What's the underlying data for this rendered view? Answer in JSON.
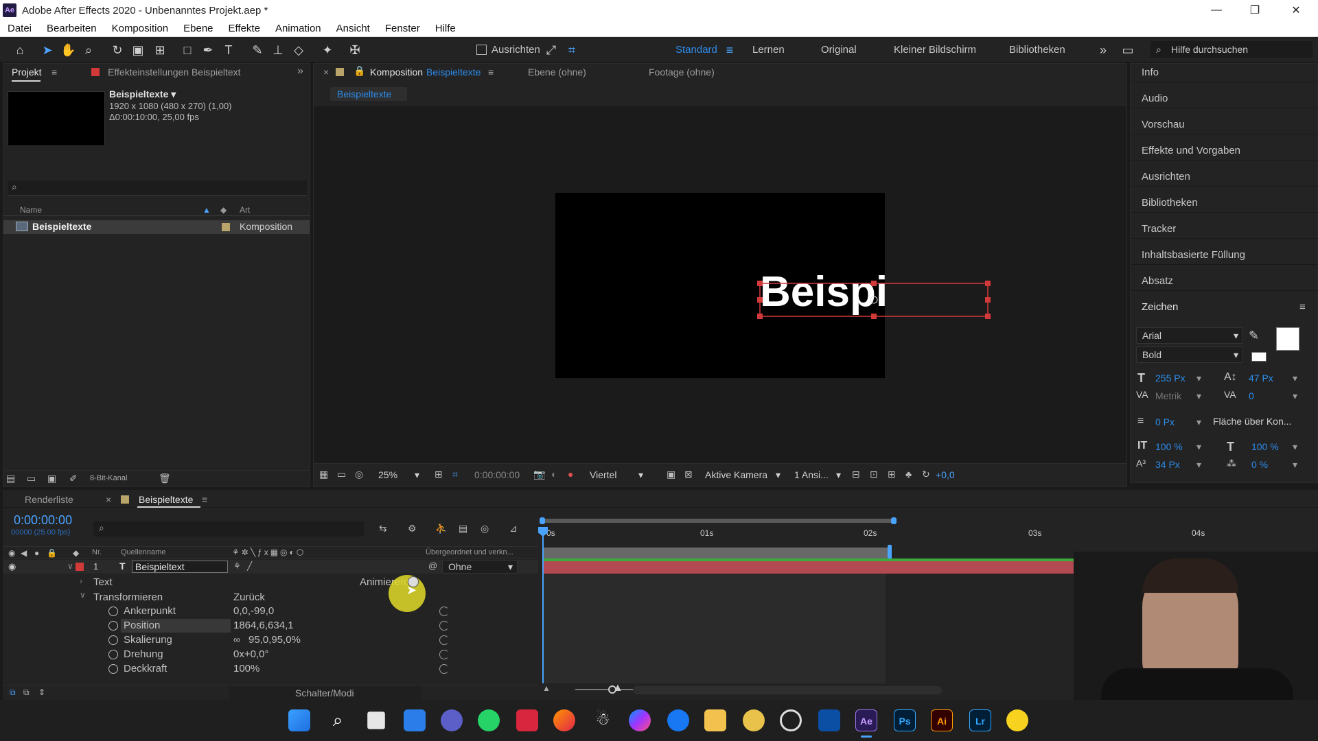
{
  "window": {
    "title": "Adobe After Effects 2020 - Unbenanntes Projekt.aep *",
    "logo": "Ae",
    "minimize": "—",
    "maximize": "❐",
    "close": "✕"
  },
  "menu": [
    "Datei",
    "Bearbeiten",
    "Komposition",
    "Ebene",
    "Effekte",
    "Animation",
    "Ansicht",
    "Fenster",
    "Hilfe"
  ],
  "toolbar": {
    "align_label": "Ausrichten",
    "workspaces": [
      "Standard",
      "Lernen",
      "Original",
      "Kleiner Bildschirm",
      "Bibliotheken"
    ],
    "help_placeholder": "Hilfe durchsuchen"
  },
  "project": {
    "tab_project": "Projekt",
    "tab_effects": "Effekteinstellungen Beispieltext",
    "comp_name": "Beispieltexte ▾",
    "comp_info1": "1920 x 1080 (480 x 270) (1,00)",
    "comp_info2": "Δ0:00:10:00, 25,00 fps",
    "col_name": "Name",
    "col_type": "Art",
    "item_name": "Beispieltexte",
    "item_type": "Komposition",
    "bitdepth": "8-Bit-Kanal"
  },
  "viewer": {
    "tab_comp_prefix": "Komposition",
    "tab_comp_name": "Beispieltexte",
    "tab_layer": "Ebene (ohne)",
    "tab_footage": "Footage (ohne)",
    "breadcrumb": "Beispieltexte",
    "canvas_text": "Beispi",
    "zoom": "25%",
    "time": "0:00:00:00",
    "resolution": "Viertel",
    "camera": "Aktive Kamera",
    "views": "1 Ansi...",
    "exposure": "+0,0"
  },
  "right_panel": {
    "items": [
      "Info",
      "Audio",
      "Vorschau",
      "Effekte und Vorgaben",
      "Ausrichten",
      "Bibliotheken",
      "Tracker",
      "Inhaltsbasierte Füllung",
      "Absatz"
    ],
    "zeichen": "Zeichen",
    "font": "Arial",
    "style": "Bold",
    "font_size": "255 Px",
    "leading": "47 Px",
    "kerning": "Metrik",
    "tracking": "0",
    "stroke_width": "0 Px",
    "stroke_type": "Fläche über Kon...",
    "vscale": "100 %",
    "hscale": "100 %",
    "baseline": "34 Px",
    "tsume": "0 %",
    "fill_color": "#ffffff",
    "stroke_color": "#000000"
  },
  "timeline": {
    "tab_render": "Renderliste",
    "tab_comp": "Beispieltexte",
    "timecode": "0:00:00:00",
    "frames": "00000 (25.00 fps)",
    "col_nr": "Nr.",
    "col_source": "Quellenname",
    "col_parent": "Übergeordnet und verkn...",
    "layer_nr": "1",
    "layer_type_icon": "T",
    "layer_name": "Beispieltext",
    "parent_value": "Ohne",
    "text_group": "Text",
    "animate": "Animieren:",
    "transform_group": "Transformieren",
    "reset": "Zurück",
    "properties": [
      {
        "name": "Ankerpunkt",
        "value": "0,0,-99,0"
      },
      {
        "name": "Position",
        "value": "1864,6,634,1"
      },
      {
        "name": "Skalierung",
        "value": "95,0,95,0%"
      },
      {
        "name": "Drehung",
        "value": "0x+0,0°"
      },
      {
        "name": "Deckkraft",
        "value": "100%"
      }
    ],
    "ruler": [
      "0s",
      "01s",
      "02s",
      "03s",
      "04s"
    ],
    "switches_label": "Schalter/Modi"
  },
  "taskbar": {
    "apps": [
      "windows-start-icon",
      "search-icon",
      "task-view-icon",
      "widgets-icon",
      "teams-chat-icon",
      "whatsapp-icon",
      "screen-recorder-icon",
      "firefox-icon",
      "app-icon",
      "messenger-icon",
      "facebook-icon",
      "file-explorer-icon",
      "chrome-canary-icon",
      "obs-icon",
      "capcut-icon",
      "after-effects-icon",
      "photoshop-icon",
      "illustrator-icon",
      "lightroom-icon",
      "norton-icon"
    ],
    "labels": {
      "ae": "Ae",
      "ps": "Ps",
      "ai": "Ai",
      "lr": "Lr"
    }
  }
}
